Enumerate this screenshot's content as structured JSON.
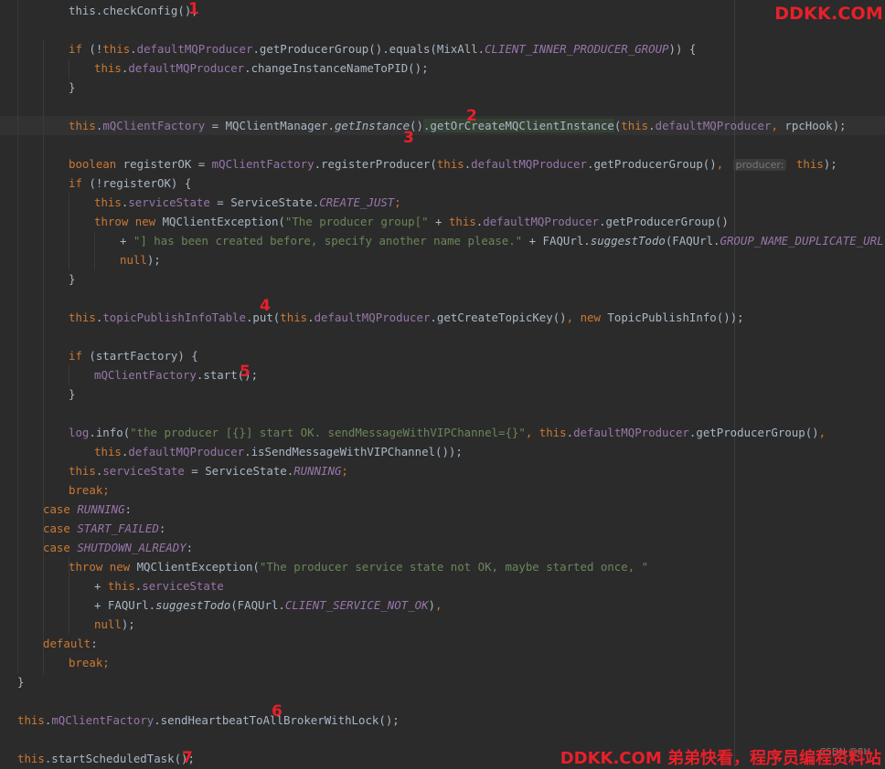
{
  "editor": {
    "lines": [
      {
        "n": 0,
        "segs": [
          [
            "p",
            "this.checkConfig();"
          ]
        ]
      },
      {
        "n": 2,
        "segs": [
          [
            "k",
            "if"
          ],
          [
            "p",
            " (!"
          ],
          [
            "k",
            "this"
          ],
          [
            "p",
            "."
          ],
          [
            "f",
            "defaultMQProducer"
          ],
          [
            "p",
            ".getProducerGroup().equals(MixAll."
          ],
          [
            "fi",
            "CLIENT_INNER_PRODUCER_GROUP"
          ],
          [
            "p",
            ")) {"
          ]
        ]
      },
      {
        "n": 3,
        "segs": [
          [
            "k",
            "this"
          ],
          [
            "p",
            "."
          ],
          [
            "f",
            "defaultMQProducer"
          ],
          [
            "p",
            ".changeInstanceNameToPID();"
          ]
        ]
      },
      {
        "n": 4,
        "segs": [
          [
            "p",
            "}"
          ]
        ]
      },
      {
        "n": 6,
        "segs": [
          [
            "k",
            "this"
          ],
          [
            "p",
            "."
          ],
          [
            "f",
            "mQClientFactory"
          ],
          [
            "p",
            " = MQClientManager."
          ],
          [
            "mi",
            "getInstance"
          ],
          [
            "p",
            "()"
          ],
          [
            "hl",
            ".getOrCreateMQClientInstance"
          ],
          [
            "p",
            "("
          ],
          [
            "k",
            "this"
          ],
          [
            "p",
            "."
          ],
          [
            "f",
            "defaultMQProducer"
          ],
          [
            "k",
            ","
          ],
          [
            "p",
            " rpcHook);"
          ]
        ]
      },
      {
        "n": 8,
        "segs": [
          [
            "k",
            "boolean"
          ],
          [
            "p",
            " registerOK = "
          ],
          [
            "f",
            "mQClientFactory"
          ],
          [
            "p",
            ".registerProducer("
          ],
          [
            "k",
            "this"
          ],
          [
            "p",
            "."
          ],
          [
            "f",
            "defaultMQProducer"
          ],
          [
            "p",
            ".getProducerGroup()"
          ],
          [
            "k",
            ","
          ],
          [
            "p",
            " "
          ],
          [
            "h",
            "producer:"
          ],
          [
            "p",
            " "
          ],
          [
            "k",
            "this"
          ],
          [
            "p",
            ");"
          ]
        ]
      },
      {
        "n": 9,
        "segs": [
          [
            "k",
            "if"
          ],
          [
            "p",
            " (!registerOK) {"
          ]
        ]
      },
      {
        "n": 10,
        "segs": [
          [
            "k",
            "this"
          ],
          [
            "p",
            "."
          ],
          [
            "f",
            "serviceState"
          ],
          [
            "p",
            " = ServiceState."
          ],
          [
            "fi",
            "CREATE_JUST"
          ],
          [
            "k",
            ";"
          ]
        ]
      },
      {
        "n": 11,
        "segs": [
          [
            "k",
            "throw new"
          ],
          [
            "p",
            " MQClientException("
          ],
          [
            "s",
            "\"The producer group[\""
          ],
          [
            "p",
            " + "
          ],
          [
            "k",
            "this"
          ],
          [
            "p",
            "."
          ],
          [
            "f",
            "defaultMQProducer"
          ],
          [
            "p",
            ".getProducerGroup()"
          ]
        ]
      },
      {
        "n": 12,
        "segs": [
          [
            "p",
            "+ "
          ],
          [
            "s",
            "\"] has been created before, specify another name please.\""
          ],
          [
            "p",
            " + FAQUrl."
          ],
          [
            "mi",
            "suggestTodo"
          ],
          [
            "p",
            "(FAQUrl."
          ],
          [
            "fi",
            "GROUP_NAME_DUPLICATE_URL"
          ],
          [
            "p",
            ")"
          ],
          [
            "k",
            ","
          ]
        ]
      },
      {
        "n": 13,
        "segs": [
          [
            "k",
            "null"
          ],
          [
            "p",
            ");"
          ]
        ]
      },
      {
        "n": 14,
        "segs": [
          [
            "p",
            "}"
          ]
        ]
      },
      {
        "n": 16,
        "segs": [
          [
            "k",
            "this"
          ],
          [
            "p",
            "."
          ],
          [
            "f",
            "topicPublishInfoTable"
          ],
          [
            "p",
            ".put("
          ],
          [
            "k",
            "this"
          ],
          [
            "p",
            "."
          ],
          [
            "f",
            "defaultMQProducer"
          ],
          [
            "p",
            ".getCreateTopicKey()"
          ],
          [
            "k",
            ","
          ],
          [
            "p",
            " "
          ],
          [
            "k",
            "new"
          ],
          [
            "p",
            " TopicPublishInfo());"
          ]
        ]
      },
      {
        "n": 18,
        "segs": [
          [
            "k",
            "if"
          ],
          [
            "p",
            " (startFactory) {"
          ]
        ]
      },
      {
        "n": 19,
        "segs": [
          [
            "f",
            "mQClientFactory"
          ],
          [
            "p",
            ".start();"
          ]
        ]
      },
      {
        "n": 20,
        "segs": [
          [
            "p",
            "}"
          ]
        ]
      },
      {
        "n": 22,
        "segs": [
          [
            "f",
            "log"
          ],
          [
            "p",
            ".info("
          ],
          [
            "s",
            "\"the producer [{}] start OK. sendMessageWithVIPChannel={}\""
          ],
          [
            "k",
            ","
          ],
          [
            "p",
            " "
          ],
          [
            "k",
            "this"
          ],
          [
            "p",
            "."
          ],
          [
            "f",
            "defaultMQProducer"
          ],
          [
            "p",
            ".getProducerGroup()"
          ],
          [
            "k",
            ","
          ]
        ]
      },
      {
        "n": 23,
        "segs": [
          [
            "k",
            "this"
          ],
          [
            "p",
            "."
          ],
          [
            "f",
            "defaultMQProducer"
          ],
          [
            "p",
            ".isSendMessageWithVIPChannel());"
          ]
        ]
      },
      {
        "n": 24,
        "segs": [
          [
            "k",
            "this"
          ],
          [
            "p",
            "."
          ],
          [
            "f",
            "serviceState"
          ],
          [
            "p",
            " = ServiceState."
          ],
          [
            "fi",
            "RUNNING"
          ],
          [
            "k",
            ";"
          ]
        ]
      },
      {
        "n": 25,
        "segs": [
          [
            "k",
            "break;"
          ]
        ]
      },
      {
        "n": 26,
        "segs": [
          [
            "k",
            "case"
          ],
          [
            "p",
            " "
          ],
          [
            "fi",
            "RUNNING"
          ],
          [
            "p",
            ":"
          ]
        ]
      },
      {
        "n": 27,
        "segs": [
          [
            "k",
            "case"
          ],
          [
            "p",
            " "
          ],
          [
            "fi",
            "START_FAILED"
          ],
          [
            "p",
            ":"
          ]
        ]
      },
      {
        "n": 28,
        "segs": [
          [
            "k",
            "case"
          ],
          [
            "p",
            " "
          ],
          [
            "fi",
            "SHUTDOWN_ALREADY"
          ],
          [
            "p",
            ":"
          ]
        ]
      },
      {
        "n": 29,
        "segs": [
          [
            "k",
            "throw new"
          ],
          [
            "p",
            " MQClientException("
          ],
          [
            "s",
            "\"The producer service state not OK, maybe started once, \""
          ]
        ]
      },
      {
        "n": 30,
        "segs": [
          [
            "p",
            "+ "
          ],
          [
            "k",
            "this"
          ],
          [
            "p",
            "."
          ],
          [
            "f",
            "serviceState"
          ]
        ]
      },
      {
        "n": 31,
        "segs": [
          [
            "p",
            "+ FAQUrl."
          ],
          [
            "mi",
            "suggestTodo"
          ],
          [
            "p",
            "(FAQUrl."
          ],
          [
            "fi",
            "CLIENT_SERVICE_NOT_OK"
          ],
          [
            "p",
            ")"
          ],
          [
            "k",
            ","
          ]
        ]
      },
      {
        "n": 32,
        "segs": [
          [
            "k",
            "null"
          ],
          [
            "p",
            ");"
          ]
        ]
      },
      {
        "n": 33,
        "segs": [
          [
            "k",
            "default"
          ],
          [
            "p",
            ":"
          ]
        ]
      },
      {
        "n": 34,
        "segs": [
          [
            "k",
            "break;"
          ]
        ]
      },
      {
        "n": 35,
        "segs": [
          [
            "p",
            "}"
          ]
        ]
      },
      {
        "n": 37,
        "segs": [
          [
            "k",
            "this"
          ],
          [
            "p",
            "."
          ],
          [
            "f",
            "mQClientFactory"
          ],
          [
            "p",
            ".sendHeartbeatToAllBrokerWithLock();"
          ]
        ]
      },
      {
        "n": 39,
        "segs": [
          [
            "k",
            "this"
          ],
          [
            "p",
            ".startScheduledTask();"
          ]
        ]
      }
    ]
  },
  "markers": [
    "1",
    "2",
    "3",
    "4",
    "5",
    "6",
    "7"
  ],
  "watermark": {
    "top_right": "DDKK.COM",
    "bottom_right": "DDKK.COM 弟弟快看，程序员编程资料站",
    "bottom_faint": "CSDN @SH"
  },
  "colors": {
    "background": "#2b2b2b",
    "keyword": "#cc7832",
    "field": "#9876aa",
    "string": "#6a8759",
    "plain": "#a9b7c6",
    "annotation_red": "#e8202a"
  }
}
